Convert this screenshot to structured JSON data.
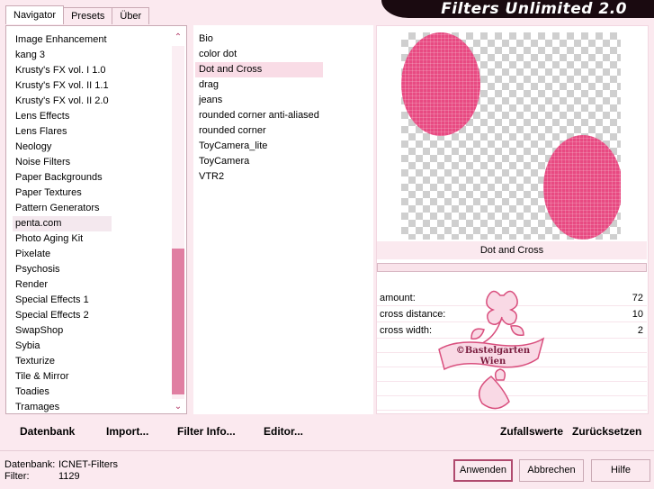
{
  "tabs": [
    "Navigator",
    "Presets",
    "Über"
  ],
  "title": "Filters Unlimited 2.0",
  "categories": [
    "Image Enhancement",
    "kang 3",
    "Krusty's FX vol. I 1.0",
    "Krusty's FX vol. II 1.1",
    "Krusty's FX vol. II 2.0",
    "Lens Effects",
    "Lens Flares",
    "Neology",
    "Noise Filters",
    "Paper Backgrounds",
    "Paper Textures",
    "Pattern Generators",
    "penta.com",
    "Photo Aging Kit",
    "Pixelate",
    "Psychosis",
    "Render",
    "Special Effects 1",
    "Special Effects 2",
    "SwapShop",
    "Sybia",
    "Texturize",
    "Tile & Mirror",
    "Toadies",
    "Tramages"
  ],
  "selected_category": "penta.com",
  "filters": [
    "Bio",
    "color dot",
    "Dot and Cross",
    "drag",
    "jeans",
    "rounded corner anti-aliased",
    "rounded corner",
    "ToyCamera_lite",
    "ToyCamera",
    "VTR2"
  ],
  "selected_filter": "Dot and Cross",
  "preview_title": "Dot and Cross",
  "params": [
    {
      "label": "amount:",
      "value": "72"
    },
    {
      "label": "cross distance:",
      "value": "10"
    },
    {
      "label": "cross width:",
      "value": "2"
    }
  ],
  "watermark": {
    "line1": "©Bastelgarten",
    "line2": "Wien"
  },
  "left_actions": [
    "Datenbank",
    "Import...",
    "Filter Info...",
    "Editor..."
  ],
  "right_actions": [
    "Zufallswerte",
    "Zurücksetzen"
  ],
  "status": {
    "db_label": "Datenbank:",
    "db_value": "ICNET-Filters",
    "filter_label": "Filter:",
    "filter_value": "1129"
  },
  "buttons": {
    "apply": "Anwenden",
    "cancel": "Abbrechen",
    "help": "Hilfe"
  },
  "colors": {
    "accent": "#e84a82",
    "panel": "#fbe9ef",
    "scroll_thumb": "#e07fa2"
  }
}
